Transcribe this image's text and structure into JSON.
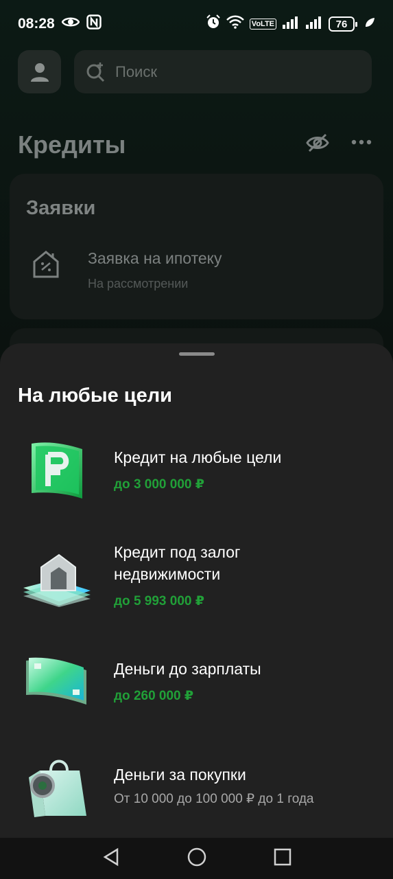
{
  "status_bar": {
    "time": "08:28",
    "battery": "76",
    "volte": "VoLTE"
  },
  "search": {
    "placeholder": "Поиск"
  },
  "page": {
    "title": "Кредиты"
  },
  "applications": {
    "title": "Заявки",
    "item_title": "Заявка на ипотеку",
    "item_status": "На рассмотрении"
  },
  "sheet": {
    "title": "На любые цели",
    "products": [
      {
        "name": "Кредит на любые цели",
        "amount": "до 3 000 000 ₽",
        "icon": "ruble-banknotes-icon"
      },
      {
        "name_line1": "Кредит под залог",
        "name_line2": "недвижимости",
        "amount": "до 5 993 000 ₽",
        "icon": "house-banknotes-icon"
      },
      {
        "name": "Деньги до зарплаты",
        "amount": "до 260 000 ₽",
        "icon": "banknotes-icon"
      },
      {
        "name": "Деньги за покупки",
        "desc": "От 10 000 до 100 000 ₽ до 1 года",
        "icon": "shopping-bag-icon"
      }
    ]
  },
  "colors": {
    "accent_green": "#21a038",
    "sheet_bg": "#212121"
  }
}
